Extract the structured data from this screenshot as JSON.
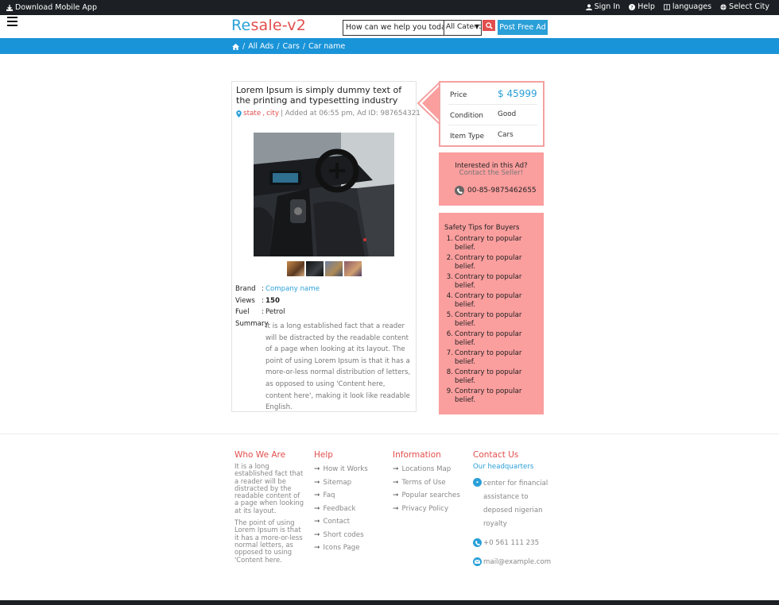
{
  "topbar": {
    "download_label": "Download Mobile App",
    "sign_in": "Sign In",
    "help": "Help",
    "languages": "languages",
    "select_city": "Select City"
  },
  "header": {
    "logo_part1": "Re",
    "logo_part2": "sale-v2",
    "search_value": "How can we help you today?",
    "category_value": "All Categories",
    "post_label": "Post Free Ad"
  },
  "breadcrumb": {
    "items": [
      "All Ads",
      "Cars",
      "Car name"
    ],
    "separator": "/"
  },
  "ad": {
    "title": "Lorem Ipsum is simply dummy text of the printing and typesetting industry",
    "location_state": "state",
    "location_city": "city",
    "meta": "| Added at 06:55 pm, Ad ID: 987654321",
    "specs": [
      {
        "label": "Brand",
        "value": "Company name"
      },
      {
        "label": "Views",
        "value": "150"
      },
      {
        "label": "Fuel",
        "value": "Petrol"
      },
      {
        "label": "Summary",
        "value": ""
      }
    ],
    "summary": "It is a long established fact that a reader will be distracted by the readable content of a page when looking at its layout. The point of using Lorem Ipsum is that it has a more-or-less normal distribution of letters, as opposed to using 'Content here, content here', making it look like readable English."
  },
  "price_box": {
    "price_label": "Price",
    "price_value": "$ 45999",
    "condition_label": "Condition",
    "condition_value": "Good",
    "type_label": "Item Type",
    "type_value": "Cars"
  },
  "contact_box": {
    "line1": "Interested in this Ad?",
    "line2": "Contact the Seller!",
    "phone": "00-85-9875462655"
  },
  "tips": {
    "title": "Safety Tips for Buyers",
    "items": [
      "Contrary to popular belief.",
      "Contrary to popular belief.",
      "Contrary to popular belief.",
      "Contrary to popular belief.",
      "Contrary to popular belief.",
      "Contrary to popular belief.",
      "Contrary to popular belief.",
      "Contrary to popular belief.",
      "Contrary to popular belief."
    ]
  },
  "footer": {
    "who": {
      "title": "Who We Are",
      "p1": "It is a long established fact that a reader will be distracted by the readable content of a page when looking at its layout.",
      "p2": "The point of using Lorem Ipsum is that it has a more-or-less normal letters, as opposed to using 'Content here."
    },
    "help": {
      "title": "Help",
      "links": [
        "How it Works",
        "Sitemap",
        "Faq",
        "Feedback",
        "Contact",
        "Short codes",
        "Icons Page"
      ]
    },
    "info": {
      "title": "Information",
      "links": [
        "Locations Map",
        "Terms of Use",
        "Popular searches",
        "Privacy Policy"
      ]
    },
    "contact": {
      "title": "Contact Us",
      "hq": "Our headquarters",
      "address": "center for financial assistance to deposed nigerian royalty",
      "phone": "+0 561 111 235",
      "email": "mail@example.com"
    }
  },
  "colors": {
    "accent_blue": "#2a9fd8",
    "accent_red": "#e24d4d",
    "pink_panel": "#fb9e9e",
    "dark_bar": "#1c1f24"
  }
}
